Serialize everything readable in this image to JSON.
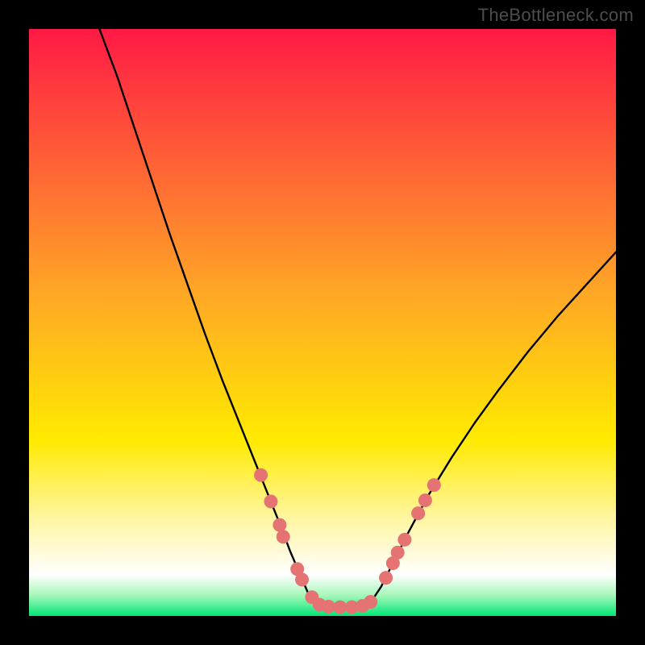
{
  "watermark": "TheBottleneck.com",
  "chart_data": {
    "type": "line",
    "title": "",
    "xlabel": "",
    "ylabel": "",
    "xlim": [
      0,
      100
    ],
    "ylim": [
      0,
      100
    ],
    "grid": false,
    "legend": false,
    "background_gradient": {
      "stops": [
        {
          "offset": 0.0,
          "color": "#ff1a45"
        },
        {
          "offset": 0.45,
          "color": "#ffa726"
        },
        {
          "offset": 0.7,
          "color": "#ffea00"
        },
        {
          "offset": 0.83,
          "color": "#fff59d"
        },
        {
          "offset": 0.93,
          "color": "#ffffff"
        },
        {
          "offset": 0.965,
          "color": "#a5f7b8"
        },
        {
          "offset": 1.0,
          "color": "#00e676"
        }
      ]
    },
    "series": [
      {
        "name": "left-curve",
        "stroke": "#000000",
        "stroke_width": 2.4,
        "x": [
          12.0,
          15.0,
          18.0,
          21.0,
          24.0,
          27.0,
          30.0,
          33.0,
          36.0,
          39.0,
          41.0,
          43.0,
          44.5,
          46.0,
          47.5,
          49.0
        ],
        "y": [
          100.0,
          92.0,
          83.0,
          74.0,
          65.0,
          56.5,
          48.0,
          40.0,
          32.5,
          25.0,
          20.0,
          15.0,
          11.0,
          7.5,
          4.0,
          2.0
        ]
      },
      {
        "name": "valley-flat",
        "stroke": "#000000",
        "stroke_width": 2.4,
        "x": [
          49.0,
          50.0,
          52.0,
          54.0,
          56.0,
          58.0
        ],
        "y": [
          2.0,
          1.6,
          1.5,
          1.5,
          1.6,
          2.0
        ]
      },
      {
        "name": "right-curve",
        "stroke": "#000000",
        "stroke_width": 2.4,
        "x": [
          58.0,
          60.0,
          62.0,
          64.5,
          68.0,
          72.0,
          76.0,
          80.0,
          85.0,
          90.0,
          95.0,
          100.0
        ],
        "y": [
          2.0,
          5.0,
          9.0,
          14.0,
          20.5,
          27.0,
          33.0,
          38.5,
          45.0,
          51.0,
          56.5,
          62.0
        ]
      }
    ],
    "scatter": {
      "name": "markers",
      "color": "#e57373",
      "radius": 8.5,
      "points": [
        {
          "x": 39.5,
          "y": 24.0
        },
        {
          "x": 41.2,
          "y": 19.5
        },
        {
          "x": 42.7,
          "y": 15.5
        },
        {
          "x": 43.3,
          "y": 13.5
        },
        {
          "x": 45.7,
          "y": 8.0
        },
        {
          "x": 46.5,
          "y": 6.2
        },
        {
          "x": 48.2,
          "y": 3.2
        },
        {
          "x": 49.5,
          "y": 1.9
        },
        {
          "x": 51.0,
          "y": 1.6
        },
        {
          "x": 53.0,
          "y": 1.5
        },
        {
          "x": 55.0,
          "y": 1.5
        },
        {
          "x": 56.8,
          "y": 1.7
        },
        {
          "x": 58.2,
          "y": 2.4
        },
        {
          "x": 60.8,
          "y": 6.5
        },
        {
          "x": 62.0,
          "y": 9.0
        },
        {
          "x": 62.8,
          "y": 10.8
        },
        {
          "x": 64.0,
          "y": 13.0
        },
        {
          "x": 66.3,
          "y": 17.5
        },
        {
          "x": 67.5,
          "y": 19.7
        },
        {
          "x": 69.0,
          "y": 22.3
        }
      ]
    }
  }
}
